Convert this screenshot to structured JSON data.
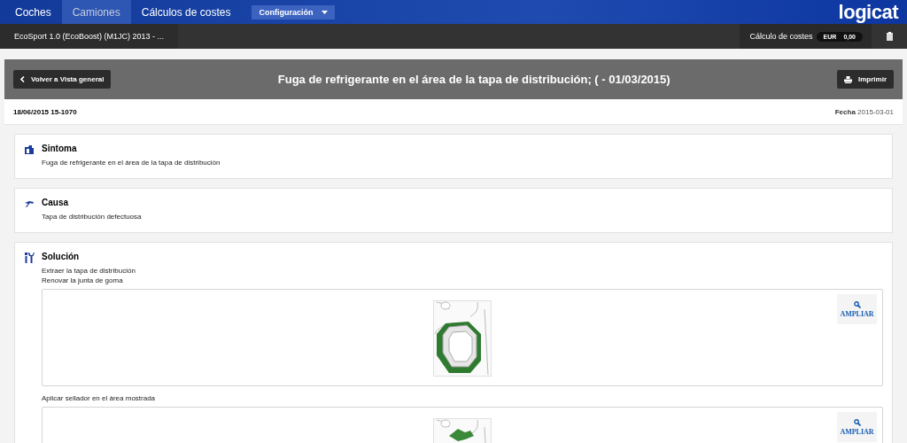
{
  "nav": {
    "tabs": [
      {
        "label": "Coches",
        "selected": false
      },
      {
        "label": "Camiones",
        "selected": true
      },
      {
        "label": "Cálculos de costes",
        "selected": false
      }
    ],
    "dropdown": "Configuración",
    "logo": "logicat"
  },
  "vehicle_bar": {
    "vehicle": "EcoSport 1.0 (EcoBoost) (M1JC) 2013 - ...",
    "cost_label": "Cálculo de costes",
    "currency": "EUR",
    "amount": "0,00"
  },
  "header": {
    "back_button": "Volver a Vista general",
    "title": "Fuga de refrigerante en el área de la tapa de distribución; ( - 01/03/2015)",
    "print_button": "Imprimir"
  },
  "meta": {
    "reference": "18/06/2015 15-1070",
    "date_label": "Fecha",
    "date": "2015-03-01"
  },
  "sections": [
    {
      "kind": "symptom",
      "title": "Sintoma",
      "items": [
        {
          "kind": "text",
          "text": "Fuga de refrigerante en el área de la tapa de distribución"
        }
      ]
    },
    {
      "kind": "cause",
      "title": "Causa",
      "items": [
        {
          "kind": "text",
          "text": "Tapa de distribución defectuosa"
        }
      ]
    },
    {
      "kind": "solution",
      "title": "Solución",
      "items": [
        {
          "kind": "text",
          "text": "Extraer la tapa de distribución"
        },
        {
          "kind": "text",
          "text": "Renovar la junta de goma"
        },
        {
          "kind": "image",
          "zoom_label": "AMPLIAR"
        },
        {
          "kind": "text",
          "text": "Aplicar sellador en el área mostrada"
        },
        {
          "kind": "image",
          "zoom_label": "AMPLIAR"
        }
      ]
    }
  ]
}
